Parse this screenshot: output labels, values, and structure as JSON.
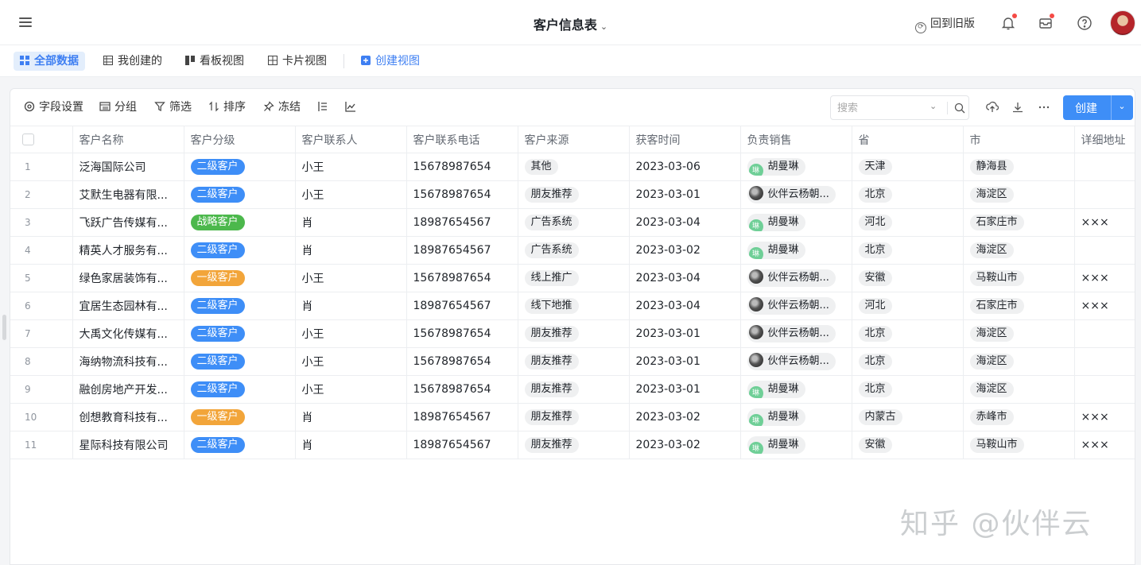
{
  "header": {
    "title": "客户信息表",
    "back_old": "回到旧版"
  },
  "views": {
    "tabs": [
      {
        "label": "全部数据",
        "active": true
      },
      {
        "label": "我创建的"
      },
      {
        "label": "看板视图"
      },
      {
        "label": "卡片视图"
      }
    ],
    "create_view": "创建视图"
  },
  "toolbar": {
    "field_settings": "字段设置",
    "group": "分组",
    "filter": "筛选",
    "sort": "排序",
    "freeze": "冻结",
    "search_placeholder": "搜索",
    "create_label": "创建"
  },
  "table": {
    "columns": [
      "客户名称",
      "客户分级",
      "客户联系人",
      "客户联系电话",
      "客户来源",
      "获客时间",
      "负责销售",
      "省",
      "市",
      "详细地址"
    ],
    "rows": [
      {
        "idx": "1",
        "name": "泛海国际公司",
        "level": "二级客户",
        "contact": "小王",
        "phone": "15678987654",
        "source": "其他",
        "date": "2023-03-06",
        "sales": "胡曼琳",
        "sales_avatar": "琳",
        "province": "天津",
        "city": "静海县",
        "address": ""
      },
      {
        "idx": "2",
        "name": "艾默生电器有限...",
        "level": "二级客户",
        "contact": "小王",
        "phone": "15678987654",
        "source": "朋友推荐",
        "date": "2023-03-01",
        "sales": "伙伴云杨朝...",
        "sales_avatar": "",
        "province": "北京",
        "city": "海淀区",
        "address": ""
      },
      {
        "idx": "3",
        "name": "飞跃广告传媒有...",
        "level": "战略客户",
        "contact": "肖",
        "phone": "18987654567",
        "source": "广告系统",
        "date": "2023-03-04",
        "sales": "胡曼琳",
        "sales_avatar": "琳",
        "province": "河北",
        "city": "石家庄市",
        "address": "×××"
      },
      {
        "idx": "4",
        "name": "精英人才服务有...",
        "level": "二级客户",
        "contact": "肖",
        "phone": "18987654567",
        "source": "广告系统",
        "date": "2023-03-02",
        "sales": "胡曼琳",
        "sales_avatar": "琳",
        "province": "北京",
        "city": "海淀区",
        "address": ""
      },
      {
        "idx": "5",
        "name": "绿色家居装饰有...",
        "level": "一级客户",
        "contact": "小王",
        "phone": "15678987654",
        "source": "线上推广",
        "date": "2023-03-04",
        "sales": "伙伴云杨朝...",
        "sales_avatar": "",
        "province": "安徽",
        "city": "马鞍山市",
        "address": "×××"
      },
      {
        "idx": "6",
        "name": "宜居生态园林有...",
        "level": "二级客户",
        "contact": "肖",
        "phone": "18987654567",
        "source": "线下地推",
        "date": "2023-03-04",
        "sales": "伙伴云杨朝...",
        "sales_avatar": "",
        "province": "河北",
        "city": "石家庄市",
        "address": "×××"
      },
      {
        "idx": "7",
        "name": "大禹文化传媒有...",
        "level": "二级客户",
        "contact": "小王",
        "phone": "15678987654",
        "source": "朋友推荐",
        "date": "2023-03-01",
        "sales": "伙伴云杨朝...",
        "sales_avatar": "",
        "province": "北京",
        "city": "海淀区",
        "address": ""
      },
      {
        "idx": "8",
        "name": "海纳物流科技有...",
        "level": "二级客户",
        "contact": "小王",
        "phone": "15678987654",
        "source": "朋友推荐",
        "date": "2023-03-01",
        "sales": "伙伴云杨朝...",
        "sales_avatar": "",
        "province": "北京",
        "city": "海淀区",
        "address": ""
      },
      {
        "idx": "9",
        "name": "融创房地产开发...",
        "level": "二级客户",
        "contact": "小王",
        "phone": "15678987654",
        "source": "朋友推荐",
        "date": "2023-03-01",
        "sales": "胡曼琳",
        "sales_avatar": "琳",
        "province": "北京",
        "city": "海淀区",
        "address": ""
      },
      {
        "idx": "10",
        "name": "创想教育科技有...",
        "level": "一级客户",
        "contact": "肖",
        "phone": "18987654567",
        "source": "朋友推荐",
        "date": "2023-03-02",
        "sales": "胡曼琳",
        "sales_avatar": "琳",
        "province": "内蒙古",
        "city": "赤峰市",
        "address": "×××"
      },
      {
        "idx": "11",
        "name": "星际科技有限公司",
        "level": "二级客户",
        "contact": "肖",
        "phone": "18987654567",
        "source": "朋友推荐",
        "date": "2023-03-02",
        "sales": "胡曼琳",
        "sales_avatar": "琳",
        "province": "安徽",
        "city": "马鞍山市",
        "address": "×××"
      }
    ]
  },
  "level_colors": {
    "二级客户": "#3e8ef7",
    "战略客户": "#4cb84c",
    "一级客户": "#f2a53a"
  },
  "watermark": "知乎 @伙伴云"
}
